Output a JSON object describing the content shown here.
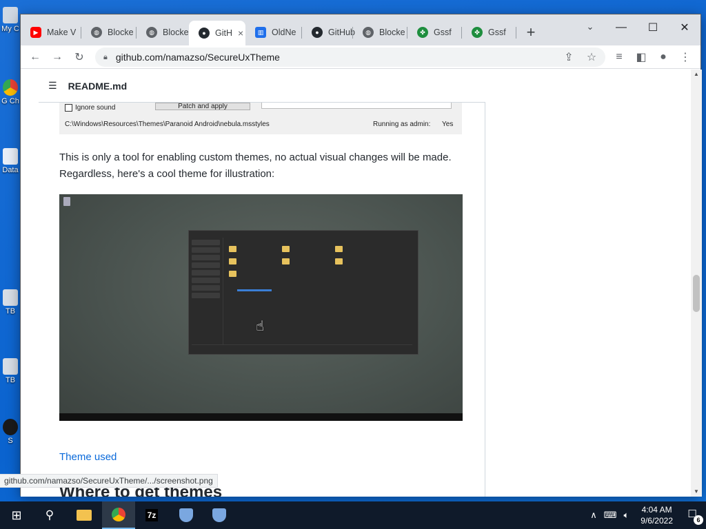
{
  "colors": {
    "desktop": "#0a63cf",
    "link": "#0969da",
    "tab_strip": "#dee1e6"
  },
  "desktop": {
    "icons": [
      {
        "label": "My C",
        "icon": "computer-icon"
      },
      {
        "label": "G Ch",
        "icon": "chrome-shortcut-icon"
      },
      {
        "label": "Data",
        "icon": "data-shortcut-icon"
      },
      {
        "label": "TB",
        "icon": "tb-shortcut-icon"
      },
      {
        "label": "TB",
        "icon": "tb-shortcut-icon"
      },
      {
        "label": "S",
        "icon": "s-shortcut-icon"
      }
    ]
  },
  "tabs": [
    {
      "label": "Make V",
      "icon": "youtube-icon",
      "color": "#ff0000"
    },
    {
      "label": "Blocke",
      "icon": "globe-icon",
      "color": "#5f6368"
    },
    {
      "label": "Blocke",
      "icon": "globe-icon",
      "color": "#5f6368"
    },
    {
      "label": "GitH",
      "icon": "github-icon",
      "color": "#24292f",
      "active": true,
      "close": "×"
    },
    {
      "label": "OldNe",
      "icon": "oldnew-icon",
      "color": "#1f6feb"
    },
    {
      "label": "GitHub",
      "icon": "github-icon",
      "color": "#24292f"
    },
    {
      "label": "Blocke",
      "icon": "globe-icon",
      "color": "#5f6368"
    },
    {
      "label": "Gssf",
      "icon": "clover-icon",
      "color": "#1e8e3e"
    },
    {
      "label": "Gssf",
      "icon": "clover-icon",
      "color": "#1e8e3e"
    }
  ],
  "newtab": "+",
  "toolbar": {
    "url": "github.com/namazso/SecureUxTheme"
  },
  "readme": {
    "title": "README.md",
    "cropped_screenshot": {
      "checkbox_label": "Ignore sound",
      "button_label": "Patch and apply",
      "path": "C:\\Windows\\Resources\\Themes\\Paranoid Android\\nebula.msstyles",
      "admin_label": "Running as admin:",
      "admin_value": "Yes"
    },
    "paragraph": "This is only a tool for enabling custom themes, no actual visual changes will be made. Regardless, here's a cool theme for illustration:",
    "theme_link": "Theme used",
    "next_heading": "Where to get themes"
  },
  "status_url": "github.com/namazso/SecureUxTheme/.../screenshot.png",
  "taskbar": {
    "items": [
      {
        "name": "start-button",
        "icon": "windows-icon"
      },
      {
        "name": "search-button",
        "icon": "search-icon"
      },
      {
        "name": "file-explorer",
        "icon": "folder-icon"
      },
      {
        "name": "chrome",
        "icon": "chrome-icon",
        "active": true
      },
      {
        "name": "7zip",
        "icon": "7z-icon",
        "text": "7z"
      },
      {
        "name": "shield-app-1",
        "icon": "shield-icon"
      },
      {
        "name": "shield-app-2",
        "icon": "shield-icon"
      }
    ],
    "time": "4:04 AM",
    "date": "9/6/2022",
    "notifications": "6"
  }
}
